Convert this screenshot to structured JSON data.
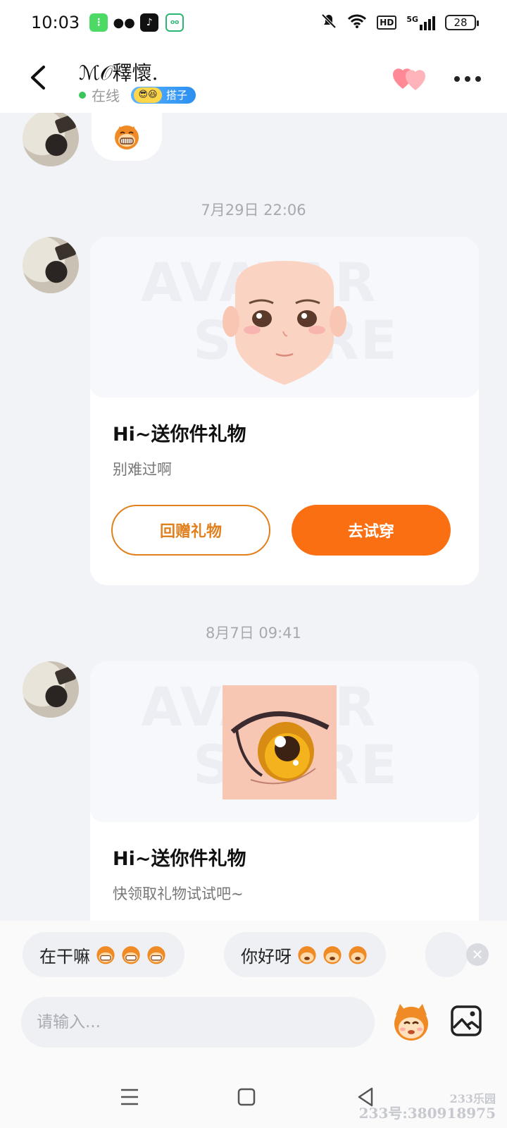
{
  "status_bar": {
    "time": "10:03",
    "battery": "28",
    "network": "5G",
    "hd": "HD"
  },
  "header": {
    "contact_name": "ℳ𝒪釋懷.",
    "status": "在线",
    "partner_badge": "搭子"
  },
  "chat": {
    "messages": [
      {
        "type": "emoji",
        "sender": "contact",
        "emoji": "monkey-grin"
      },
      {
        "type": "gift",
        "timestamp": "7月29日 22:06",
        "title": "Hi~送你件礼物",
        "subtitle": "别难过啊",
        "watermark": [
          "AVATAR",
          "STORE"
        ],
        "item": "face",
        "buttons": {
          "return_gift": "回赠礼物",
          "try_on": "去试穿"
        }
      },
      {
        "type": "gift",
        "timestamp": "8月7日 09:41",
        "title": "Hi~送你件礼物",
        "subtitle": "快领取礼物试试吧~",
        "watermark": [
          "AVATAR",
          "STORE"
        ],
        "item": "eye"
      }
    ]
  },
  "quick_replies": [
    {
      "text": "在干嘛",
      "emoji_count": 3
    },
    {
      "text": "你好呀",
      "emoji_count": 3
    }
  ],
  "input": {
    "placeholder": "请输入..."
  },
  "footer": {
    "watermark_brand": "233乐园",
    "watermark_id": "233号:380918975"
  },
  "colors": {
    "accent": "#fa6f12",
    "accent_outline": "#e0801e",
    "online": "#3cc55a",
    "background": "#f2f3f7"
  }
}
